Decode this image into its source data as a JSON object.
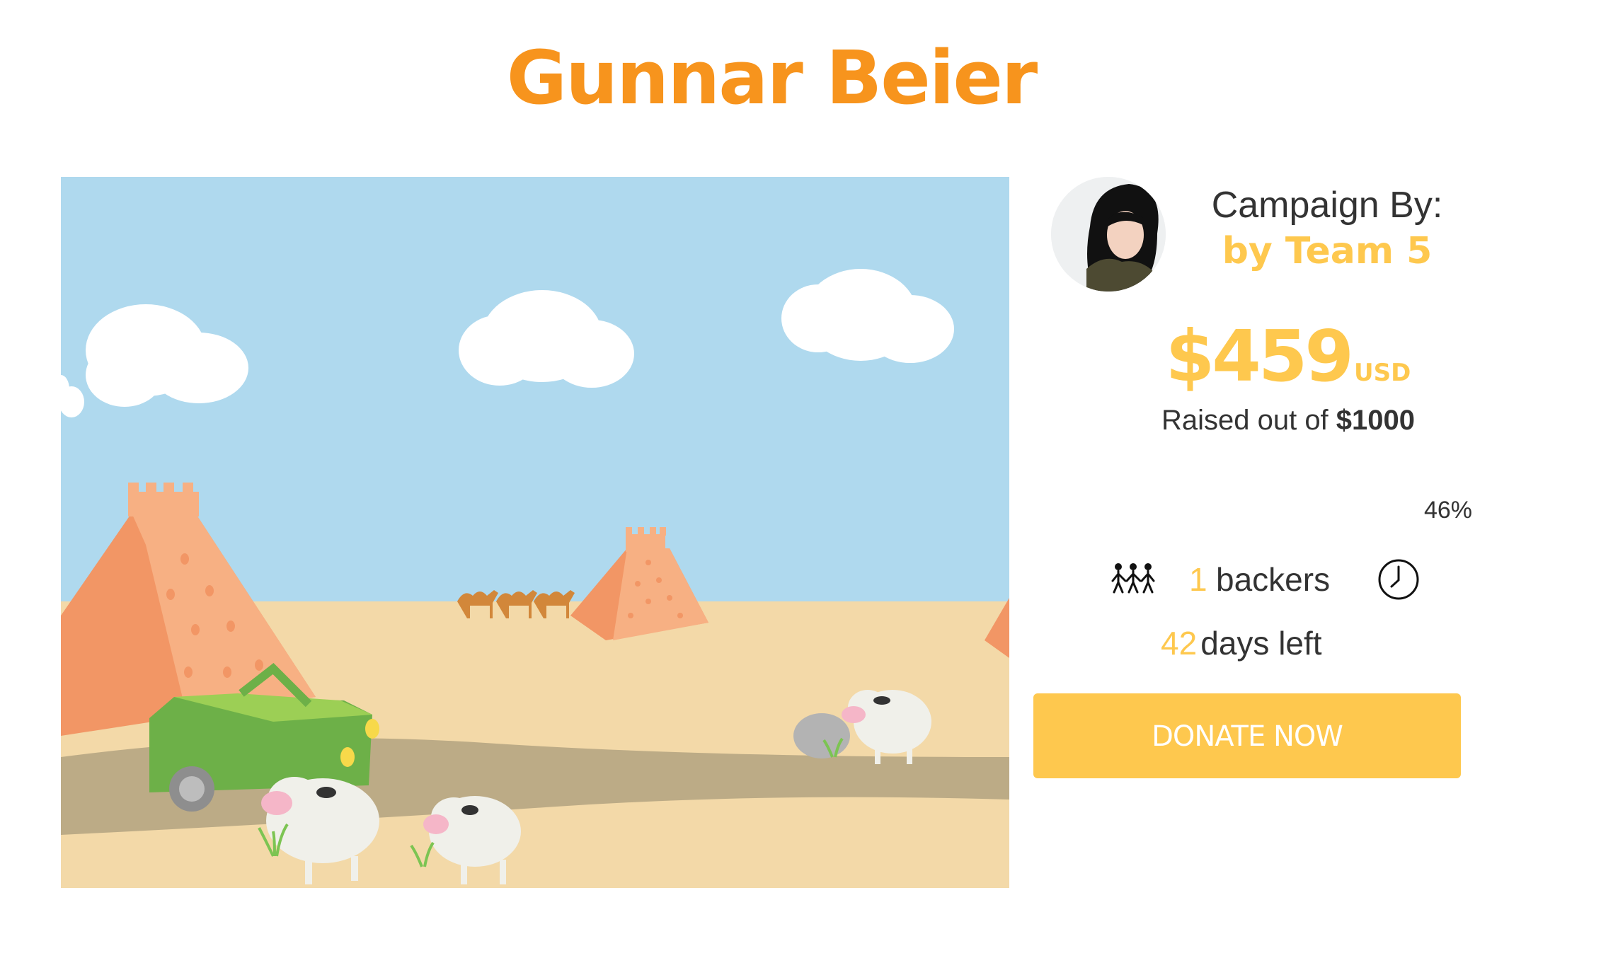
{
  "campaign": {
    "title": "Gunnar Beier"
  },
  "creator": {
    "heading": "Campaign By:",
    "name": "by Team 5"
  },
  "funding": {
    "amount": "$459",
    "currency": "USD",
    "raised_prefix": "Raised out of ",
    "goal": "$1000",
    "percent_label": "46%",
    "percent_value": 46
  },
  "stats": {
    "backers_count": "1",
    "backers_label": "backers",
    "days_count": "42",
    "days_label": "days left"
  },
  "actions": {
    "donate_label": "DONATE NOW"
  },
  "icons": {
    "backers": "people-icon",
    "time": "clock-icon"
  },
  "colors": {
    "title": "#f7941d",
    "accent": "#fec84e",
    "text": "#333333",
    "sky": "#afd9ee",
    "sand": "#f3d9a8",
    "road": "#bcab86"
  }
}
